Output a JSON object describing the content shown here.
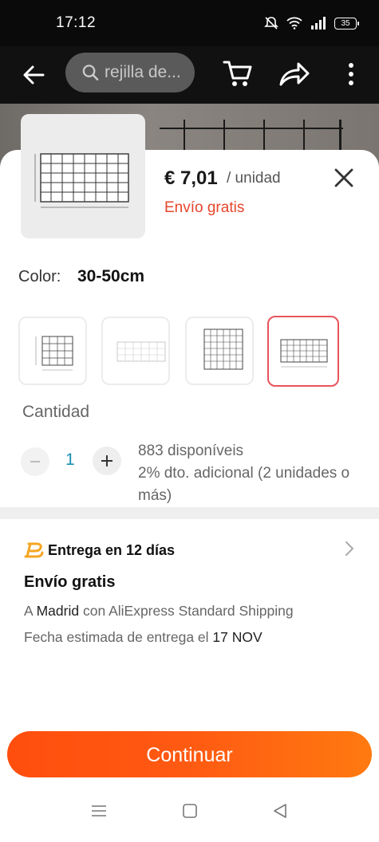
{
  "status_bar": {
    "time": "17:12",
    "battery": "35"
  },
  "top_bar": {
    "search_placeholder": "rejilla de..."
  },
  "product": {
    "price": "€ 7,01",
    "unit": "/ unidad",
    "shipping_badge": "Envío gratis"
  },
  "color": {
    "label": "Color:",
    "value": "30-50cm",
    "variants": [
      "variant-1",
      "variant-2",
      "variant-3",
      "variant-4"
    ],
    "selected_index": 3
  },
  "quantity": {
    "label": "Cantidad",
    "value": "1",
    "available": "883 disponíveis",
    "discount": "2% dto. adicional (2 unidades o más)"
  },
  "delivery": {
    "title": "Entrega en 12 días",
    "shipping_title": "Envío gratis",
    "destination_prefix": "A",
    "destination_city": "Madrid",
    "destination_suffix": "con AliExpress Standard Shipping",
    "estimate_prefix": "Fecha estimada de entrega el",
    "estimate_date": "17 NOV"
  },
  "actions": {
    "continue": "Continuar"
  },
  "colors": {
    "accent": "#ff5a12",
    "shipping_red": "#e6452b",
    "selected_border": "#e8545c",
    "quantity_blue": "#1a8fb0"
  }
}
